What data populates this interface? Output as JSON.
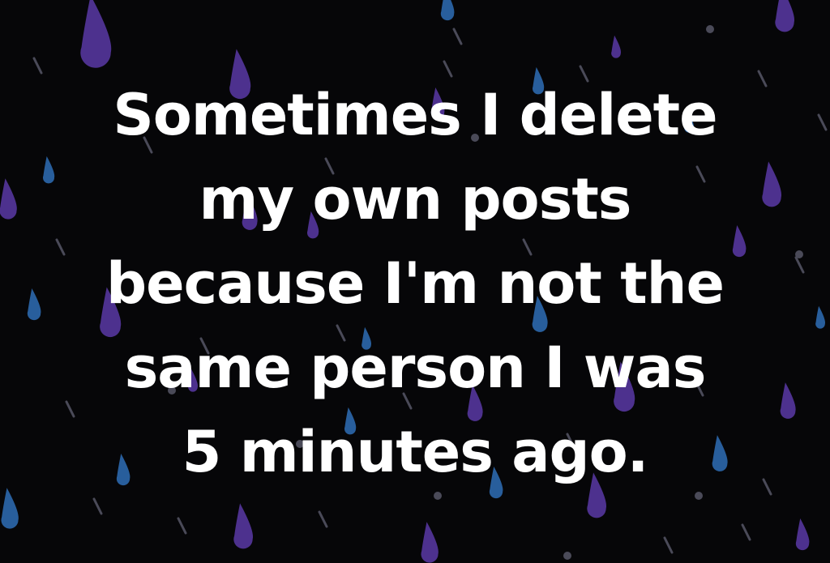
{
  "post": {
    "background": {
      "base_color": "#060608",
      "drop_colors": [
        "#5b3aa6",
        "#2f6fb6",
        "#4a4a58"
      ],
      "pattern_icon": "raindrop-icon"
    },
    "text_color": "#ffffff",
    "quote_lines": [
      "Sometimes I delete",
      "my own posts",
      "because I'm not the",
      "same person I was",
      "5 minutes ago."
    ]
  }
}
